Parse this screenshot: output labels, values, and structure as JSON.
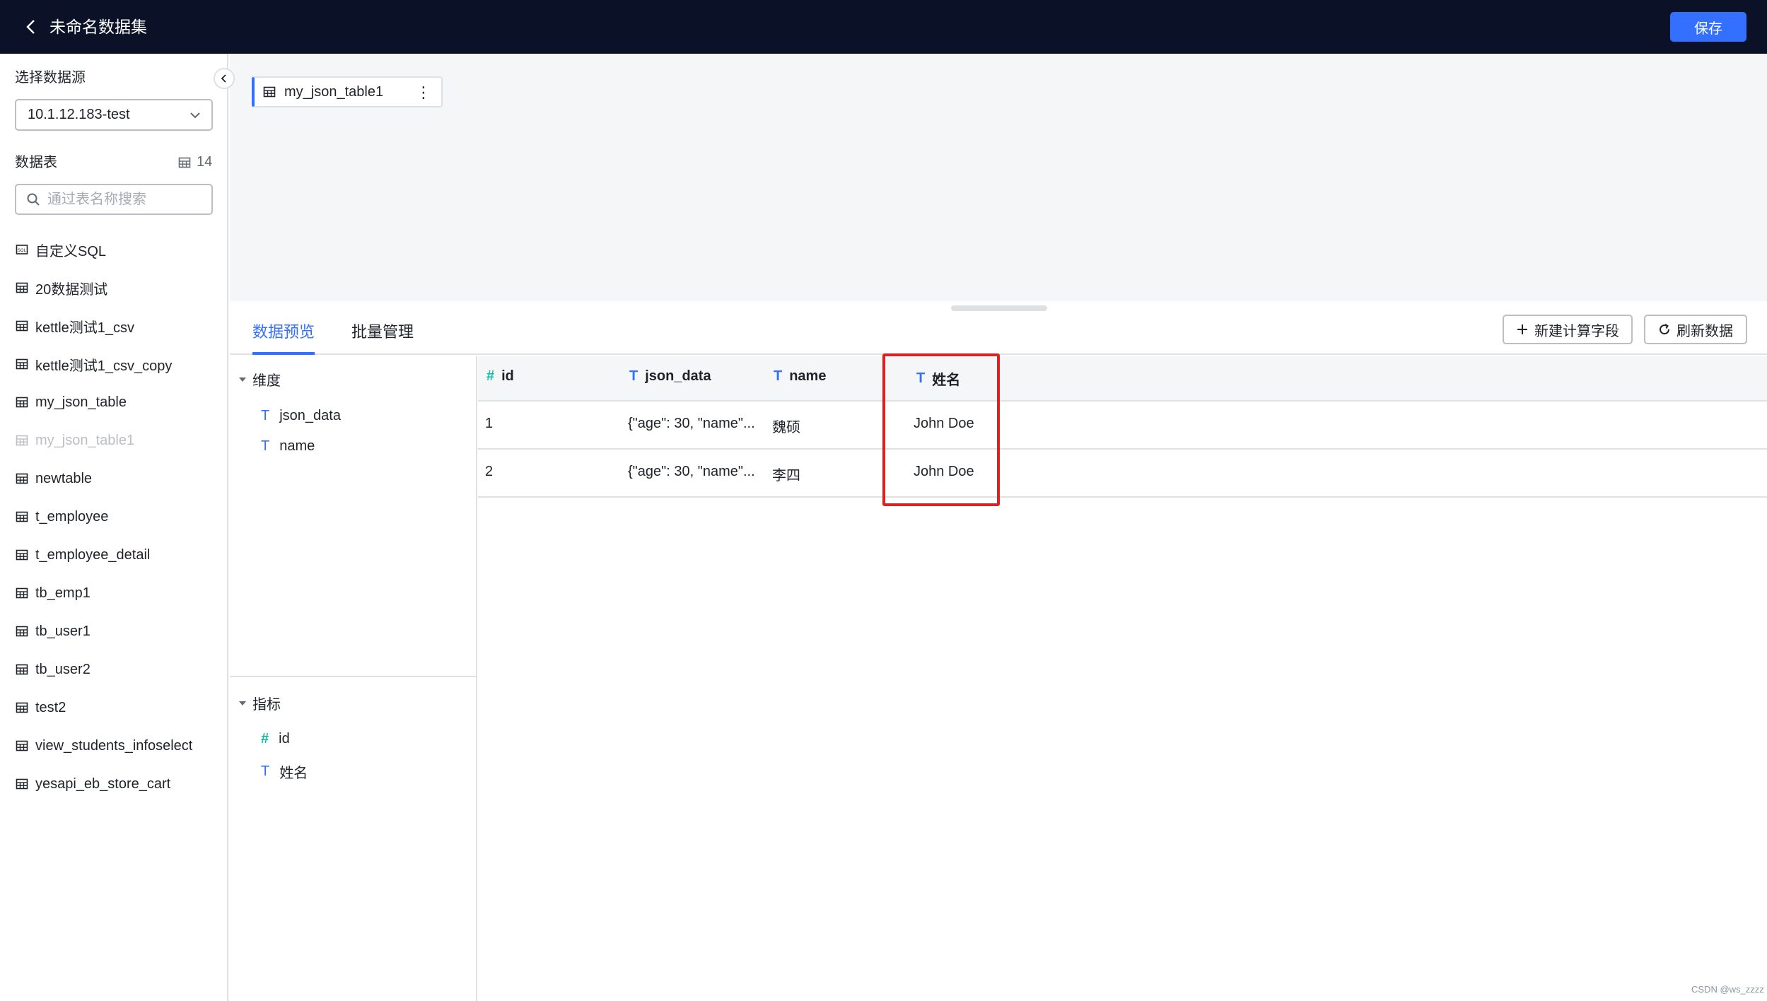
{
  "header": {
    "title": "未命名数据集",
    "save_label": "保存"
  },
  "sidebar": {
    "datasource_label": "选择数据源",
    "datasource_value": "10.1.12.183-test",
    "tables_label": "数据表",
    "tables_count": "14",
    "search_placeholder": "通过表名称搜索",
    "items": [
      {
        "label": "自定义SQL",
        "icon": "sql-icon"
      },
      {
        "label": "20数据测试",
        "icon": "table-icon"
      },
      {
        "label": "kettle测试1_csv",
        "icon": "table-icon"
      },
      {
        "label": "kettle测试1_csv_copy",
        "icon": "table-icon"
      },
      {
        "label": "my_json_table",
        "icon": "table-icon"
      },
      {
        "label": "my_json_table1",
        "icon": "table-icon",
        "disabled": true
      },
      {
        "label": "newtable",
        "icon": "table-icon"
      },
      {
        "label": "t_employee",
        "icon": "table-icon"
      },
      {
        "label": "t_employee_detail",
        "icon": "table-icon"
      },
      {
        "label": "tb_emp1",
        "icon": "table-icon"
      },
      {
        "label": "tb_user1",
        "icon": "table-icon"
      },
      {
        "label": "tb_user2",
        "icon": "table-icon"
      },
      {
        "label": "test2",
        "icon": "table-icon"
      },
      {
        "label": "view_students_infoselect",
        "icon": "table-icon"
      },
      {
        "label": "yesapi_eb_store_cart",
        "icon": "table-icon"
      }
    ]
  },
  "canvas": {
    "node_label": "my_json_table1"
  },
  "tabs": {
    "preview": "数据预览",
    "batch": "批量管理"
  },
  "toolbar": {
    "new_field": "新建计算字段",
    "refresh": "刷新数据"
  },
  "fields": {
    "dimension_title": "维度",
    "dimensions": [
      {
        "type": "T",
        "name": "json_data"
      },
      {
        "type": "T",
        "name": "name"
      }
    ],
    "metric_title": "指标",
    "metrics": [
      {
        "type": "#",
        "name": "id"
      },
      {
        "type": "T",
        "name": "姓名"
      }
    ]
  },
  "grid": {
    "columns": [
      {
        "type": "#",
        "name": "id"
      },
      {
        "type": "T",
        "name": "json_data"
      },
      {
        "type": "T",
        "name": "name"
      },
      {
        "type": "T",
        "name": "姓名"
      }
    ],
    "rows": [
      [
        "1",
        "{\"age\": 30, \"name\"...",
        "魏硕",
        "John Doe"
      ],
      [
        "2",
        "{\"age\": 30, \"name\"...",
        "李四",
        "John Doe"
      ]
    ]
  },
  "watermark": "CSDN @ws_zzzz",
  "colors": {
    "header_bg": "#0b1126",
    "accent": "#3370ff",
    "highlight": "#e02020"
  }
}
